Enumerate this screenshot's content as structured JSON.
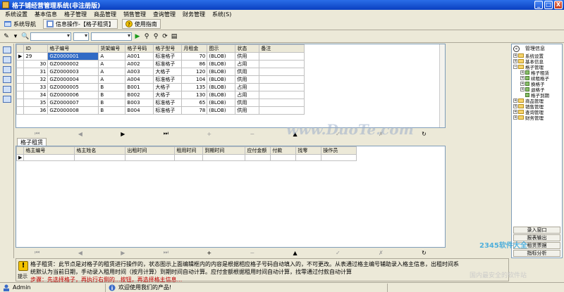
{
  "window": {
    "title": "格子铺经营管理系统(非注册版)",
    "controls": [
      "_",
      "□",
      "X"
    ]
  },
  "menu": [
    "系统设置",
    "基本信息",
    "格子管理",
    "商品管理",
    "销售管理",
    "查询管理",
    "财务管理",
    "系统(S)"
  ],
  "tabs": {
    "nav": "系统导航",
    "current": "信息操作-【格子租赁】",
    "help": "使用指南"
  },
  "grid_top": {
    "columns": [
      "ID",
      "格子编号",
      "货架编号",
      "格子号码",
      "格子型号",
      "月租金",
      "图示",
      "状态",
      "备注"
    ],
    "rows": [
      [
        "29",
        "GZ0000001",
        "A",
        "A001",
        "标准格子",
        "70",
        "(BLOB)",
        "供用",
        ""
      ],
      [
        "30",
        "GZ0000002",
        "A",
        "A002",
        "标准格子",
        "86",
        "(BLOB)",
        "占用",
        ""
      ],
      [
        "31",
        "GZ0000003",
        "A",
        "A003",
        "大格子",
        "120",
        "(BLOB)",
        "供用",
        ""
      ],
      [
        "32",
        "GZ0000004",
        "A",
        "A004",
        "标准格子",
        "104",
        "(BLOB)",
        "供用",
        ""
      ],
      [
        "33",
        "GZ0000005",
        "B",
        "B001",
        "大格子",
        "135",
        "(BLOB)",
        "占用",
        ""
      ],
      [
        "34",
        "GZ0000006",
        "B",
        "B002",
        "大格子",
        "130",
        "(BLOB)",
        "占用",
        ""
      ],
      [
        "35",
        "GZ0000007",
        "B",
        "B003",
        "标准格子",
        "65",
        "(BLOB)",
        "供用",
        ""
      ],
      [
        "36",
        "GZ0000008",
        "B",
        "B004",
        "标准格子",
        "78",
        "(BLOB)",
        "供用",
        ""
      ]
    ]
  },
  "nav_top": [
    "⏮",
    "◀",
    "▶",
    "⏭",
    "+",
    "−",
    "▲",
    "✓",
    "✗",
    "↻"
  ],
  "detail": {
    "tab": "格子租赁",
    "columns": [
      "格主编号",
      "格主姓名",
      "出租时间",
      "租用时间",
      "到期时间",
      "应付金额",
      "付款",
      "找零",
      "操作员"
    ]
  },
  "nav_bottom": [
    "⏮",
    "◀",
    "▶",
    "⏭",
    "+",
    "−",
    "▲",
    "✓",
    "✗",
    "↻"
  ],
  "tree": {
    "header": "管理信息",
    "items": [
      {
        "label": "系统设置",
        "level": 1,
        "type": "folder"
      },
      {
        "label": "基本信息",
        "level": 1,
        "type": "folder"
      },
      {
        "label": "格子管理",
        "level": 1,
        "type": "folder"
      },
      {
        "label": "格子租赁",
        "level": 2,
        "type": "leaf"
      },
      {
        "label": "续租格子",
        "level": 2,
        "type": "leaf"
      },
      {
        "label": "换格子",
        "level": 2,
        "type": "leaf"
      },
      {
        "label": "退格子",
        "level": 2,
        "type": "leaf"
      },
      {
        "label": "格子到期",
        "level": 2,
        "type": "leaf"
      },
      {
        "label": "商品管理",
        "level": 1,
        "type": "folder"
      },
      {
        "label": "销售管理",
        "level": 1,
        "type": "folder"
      },
      {
        "label": "查询管理",
        "level": 1,
        "type": "folder"
      },
      {
        "label": "财务管理",
        "level": 1,
        "type": "folder"
      }
    ],
    "buttons": [
      "录入窗口",
      "报表输出",
      "租赁票据",
      "指标分析"
    ]
  },
  "hint": {
    "label": "提示",
    "line1": "格子租赁：此节点是对格子的租赁进行操作的，状态图示上面编辑框内的内容是根据相应格子号码自动填入的，不可更改。从表通过格主编号辅助录入格主信息，出租时间系",
    "line2": "统默认为当前日期，手动录入租用时间（按月计算）到期时间自动计算。应付金额根据租用时间自动计算，找零通过付款自动计算",
    "line3": "步骤：先选择格子，再执行右侧的...按钮，再选择格主信息..."
  },
  "status": {
    "user": "Admin",
    "welcome": "欢迎使用我们的产品!"
  },
  "watermark": {
    "main": "www.DuoTe.com",
    "brand": "2345软件大全",
    "tagline": "国内最安全的软件站"
  },
  "colors": {
    "title_bar": "#0a3fc0",
    "grid_bg": "#ffffff",
    "window_bg": "#ece9d8"
  }
}
